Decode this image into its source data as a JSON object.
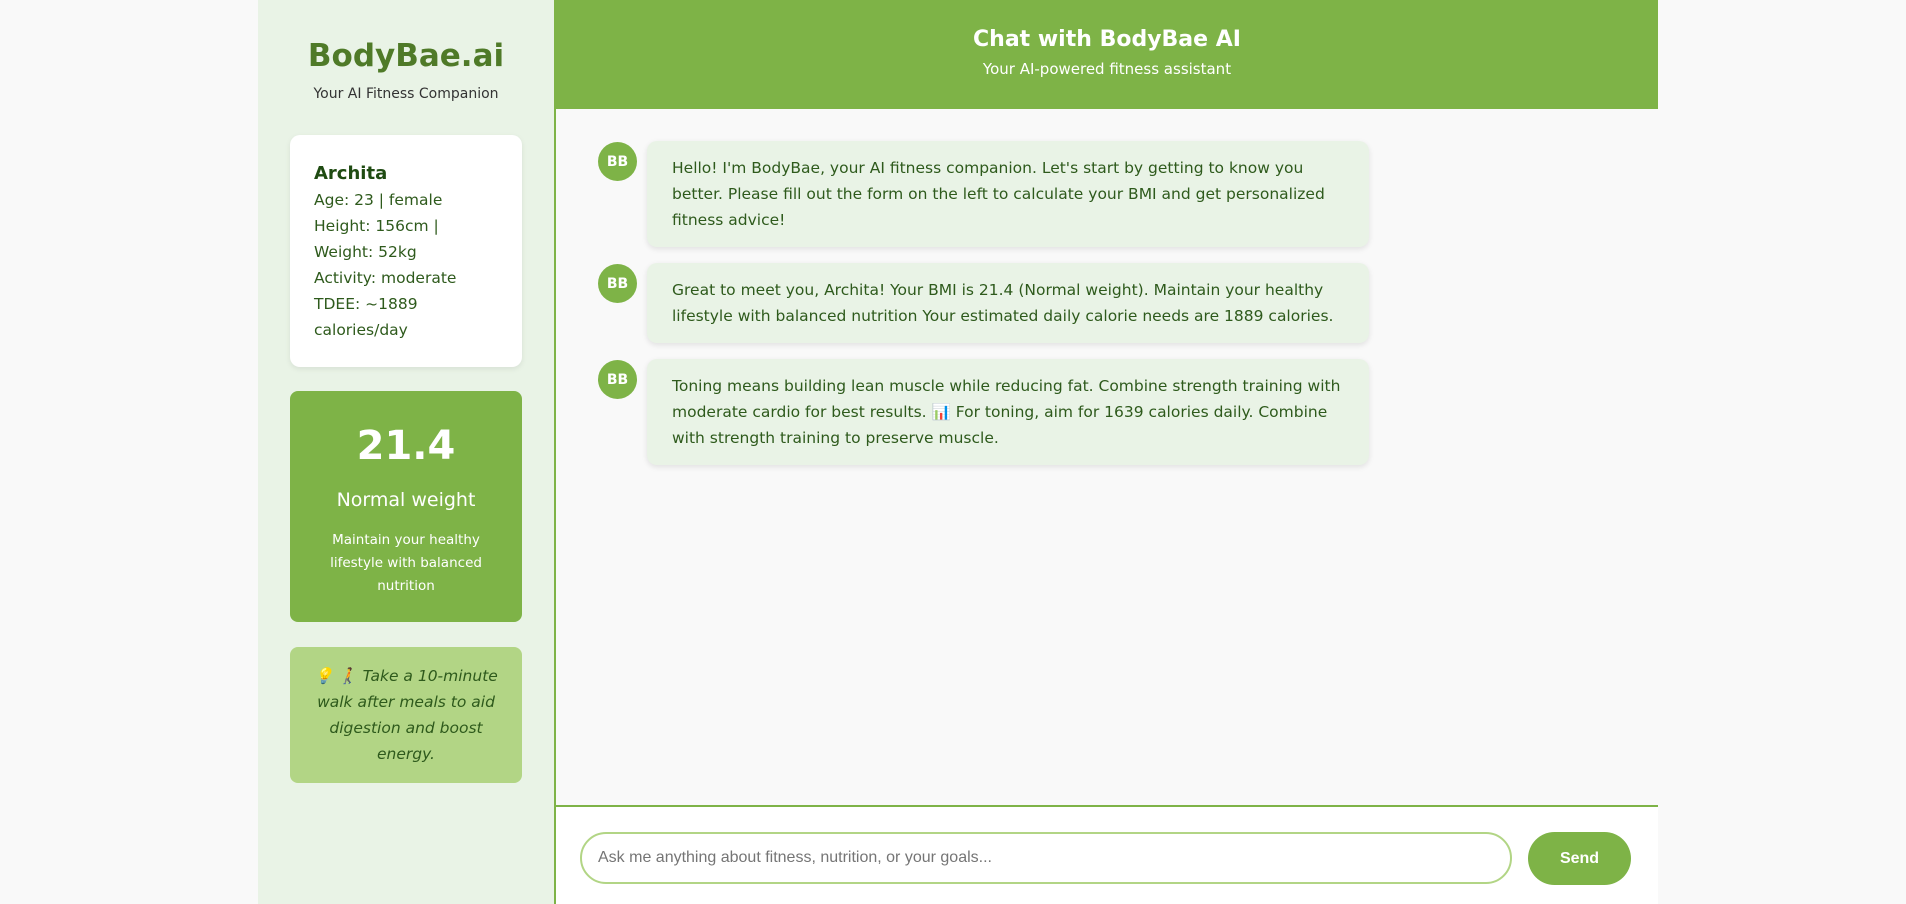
{
  "sidebar": {
    "brand": "BodyBae.ai",
    "tagline": "Your AI Fitness Companion",
    "profile": {
      "name": "Archita",
      "age_gender": "Age: 23 | female",
      "height_weight": "Height: 156cm | Weight: 52kg",
      "activity": "Activity: moderate",
      "tdee": "TDEE: ~1889 calories/day"
    },
    "bmi": {
      "value": "21.4",
      "category": "Normal weight",
      "advice": "Maintain your healthy lifestyle with balanced nutrition"
    },
    "tip": "💡 🚶 Take a 10-minute walk after meals to aid digestion and boost energy."
  },
  "chat": {
    "title": "Chat with BodyBae AI",
    "subtitle": "Your AI-powered fitness assistant",
    "messages": [
      {
        "avatar": "BB",
        "text": "Hello! I'm BodyBae, your AI fitness companion. Let's start by getting to know you better. Please fill out the form on the left to calculate your BMI and get personalized fitness advice!"
      },
      {
        "avatar": "BB",
        "text": "Great to meet you, Archita! Your BMI is 21.4 (Normal weight). Maintain your healthy lifestyle with balanced nutrition Your estimated daily calorie needs are 1889 calories."
      },
      {
        "avatar": "BB",
        "text": "Toning means building lean muscle while reducing fat. Combine strength training with moderate cardio for best results. 📊 For toning, aim for 1639 calories daily. Combine with strength training to preserve muscle."
      }
    ],
    "input_placeholder": "Ask me anything about fitness, nutrition, or your goals...",
    "input_value": "",
    "send_label": "Send"
  },
  "colors": {
    "accent": "#7eb347",
    "sidebar_bg": "#e9f3e6",
    "tip_bg": "#b2d585",
    "brand_text": "#4f7a28",
    "body_text": "#2e5a1c"
  }
}
